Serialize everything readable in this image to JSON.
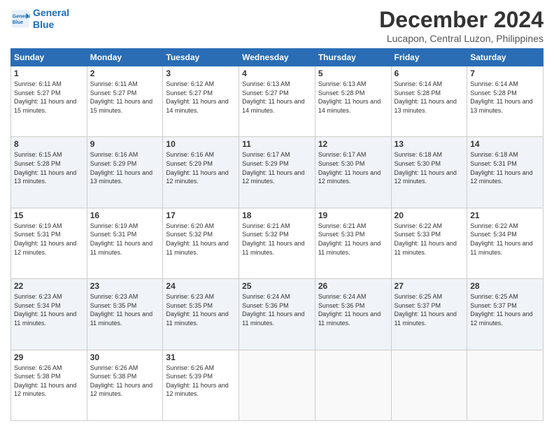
{
  "logo": {
    "line1": "General",
    "line2": "Blue"
  },
  "title": "December 2024",
  "subtitle": "Lucapon, Central Luzon, Philippines",
  "days_of_week": [
    "Sunday",
    "Monday",
    "Tuesday",
    "Wednesday",
    "Thursday",
    "Friday",
    "Saturday"
  ],
  "weeks": [
    [
      {
        "day": "1",
        "sunrise": "6:11 AM",
        "sunset": "5:27 PM",
        "daylight": "11 hours and 15 minutes."
      },
      {
        "day": "2",
        "sunrise": "6:11 AM",
        "sunset": "5:27 PM",
        "daylight": "11 hours and 15 minutes."
      },
      {
        "day": "3",
        "sunrise": "6:12 AM",
        "sunset": "5:27 PM",
        "daylight": "11 hours and 14 minutes."
      },
      {
        "day": "4",
        "sunrise": "6:13 AM",
        "sunset": "5:27 PM",
        "daylight": "11 hours and 14 minutes."
      },
      {
        "day": "5",
        "sunrise": "6:13 AM",
        "sunset": "5:28 PM",
        "daylight": "11 hours and 14 minutes."
      },
      {
        "day": "6",
        "sunrise": "6:14 AM",
        "sunset": "5:28 PM",
        "daylight": "11 hours and 13 minutes."
      },
      {
        "day": "7",
        "sunrise": "6:14 AM",
        "sunset": "5:28 PM",
        "daylight": "11 hours and 13 minutes."
      }
    ],
    [
      {
        "day": "8",
        "sunrise": "6:15 AM",
        "sunset": "5:28 PM",
        "daylight": "11 hours and 13 minutes."
      },
      {
        "day": "9",
        "sunrise": "6:16 AM",
        "sunset": "5:29 PM",
        "daylight": "11 hours and 13 minutes."
      },
      {
        "day": "10",
        "sunrise": "6:16 AM",
        "sunset": "5:29 PM",
        "daylight": "11 hours and 12 minutes."
      },
      {
        "day": "11",
        "sunrise": "6:17 AM",
        "sunset": "5:29 PM",
        "daylight": "11 hours and 12 minutes."
      },
      {
        "day": "12",
        "sunrise": "6:17 AM",
        "sunset": "5:30 PM",
        "daylight": "11 hours and 12 minutes."
      },
      {
        "day": "13",
        "sunrise": "6:18 AM",
        "sunset": "5:30 PM",
        "daylight": "11 hours and 12 minutes."
      },
      {
        "day": "14",
        "sunrise": "6:18 AM",
        "sunset": "5:31 PM",
        "daylight": "11 hours and 12 minutes."
      }
    ],
    [
      {
        "day": "15",
        "sunrise": "6:19 AM",
        "sunset": "5:31 PM",
        "daylight": "11 hours and 12 minutes."
      },
      {
        "day": "16",
        "sunrise": "6:19 AM",
        "sunset": "5:31 PM",
        "daylight": "11 hours and 11 minutes."
      },
      {
        "day": "17",
        "sunrise": "6:20 AM",
        "sunset": "5:32 PM",
        "daylight": "11 hours and 11 minutes."
      },
      {
        "day": "18",
        "sunrise": "6:21 AM",
        "sunset": "5:32 PM",
        "daylight": "11 hours and 11 minutes."
      },
      {
        "day": "19",
        "sunrise": "6:21 AM",
        "sunset": "5:33 PM",
        "daylight": "11 hours and 11 minutes."
      },
      {
        "day": "20",
        "sunrise": "6:22 AM",
        "sunset": "5:33 PM",
        "daylight": "11 hours and 11 minutes."
      },
      {
        "day": "21",
        "sunrise": "6:22 AM",
        "sunset": "5:34 PM",
        "daylight": "11 hours and 11 minutes."
      }
    ],
    [
      {
        "day": "22",
        "sunrise": "6:23 AM",
        "sunset": "5:34 PM",
        "daylight": "11 hours and 11 minutes."
      },
      {
        "day": "23",
        "sunrise": "6:23 AM",
        "sunset": "5:35 PM",
        "daylight": "11 hours and 11 minutes."
      },
      {
        "day": "24",
        "sunrise": "6:23 AM",
        "sunset": "5:35 PM",
        "daylight": "11 hours and 11 minutes."
      },
      {
        "day": "25",
        "sunrise": "6:24 AM",
        "sunset": "5:36 PM",
        "daylight": "11 hours and 11 minutes."
      },
      {
        "day": "26",
        "sunrise": "6:24 AM",
        "sunset": "5:36 PM",
        "daylight": "11 hours and 11 minutes."
      },
      {
        "day": "27",
        "sunrise": "6:25 AM",
        "sunset": "5:37 PM",
        "daylight": "11 hours and 11 minutes."
      },
      {
        "day": "28",
        "sunrise": "6:25 AM",
        "sunset": "5:37 PM",
        "daylight": "11 hours and 12 minutes."
      }
    ],
    [
      {
        "day": "29",
        "sunrise": "6:26 AM",
        "sunset": "5:38 PM",
        "daylight": "11 hours and 12 minutes."
      },
      {
        "day": "30",
        "sunrise": "6:26 AM",
        "sunset": "5:38 PM",
        "daylight": "11 hours and 12 minutes."
      },
      {
        "day": "31",
        "sunrise": "6:26 AM",
        "sunset": "5:39 PM",
        "daylight": "11 hours and 12 minutes."
      },
      null,
      null,
      null,
      null
    ]
  ]
}
